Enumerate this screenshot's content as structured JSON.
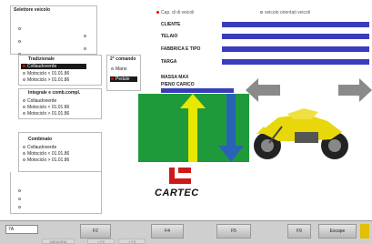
{
  "selector_title": "Selettore veicolo",
  "top_options": {
    "opt1": "Cap. di di veicoli",
    "opt2": "veicolo orientati veicoli"
  },
  "fields": [
    {
      "label": "CLIENTE"
    },
    {
      "label": "TELAIO"
    },
    {
      "label": "FABBRICA E TIPO"
    },
    {
      "label": "TARGA"
    }
  ],
  "tradizionale": {
    "title": "Tradizionale",
    "items": [
      "Collaudoverde",
      "Motociclo < 01.01.86",
      "Motociclo > 01.01.86"
    ]
  },
  "comando": {
    "title": "2° comando",
    "items": [
      "Mano",
      "Pedale"
    ]
  },
  "integrale": {
    "title": "Integrale e comb.compl.",
    "items": [
      "Collaudoverde",
      "Motociclo < 01.01.86",
      "Motociclo > 01.01.86"
    ]
  },
  "combinato": {
    "title": "Combinato",
    "items": [
      "Collaudoverde",
      "Motociclo < 01.01.86",
      "Motociclo > 01.01.86"
    ]
  },
  "mass": {
    "max": "MASSA MAX",
    "full": "PIENO CARICO"
  },
  "brand": "CARTEC",
  "footer": {
    "input_value": "7A",
    "keys": [
      "F2",
      "F4",
      "F5",
      "F9",
      "Escape"
    ],
    "sub_keys": [
      "MEMORIA",
      "+ F2",
      "+ F3"
    ]
  },
  "colors": {
    "bar": "#3a3dbb",
    "green": "#1f9a3a",
    "yellow": "#e8e800",
    "arrow_blue": "#2a63b5",
    "bike": "#e8d70a"
  }
}
